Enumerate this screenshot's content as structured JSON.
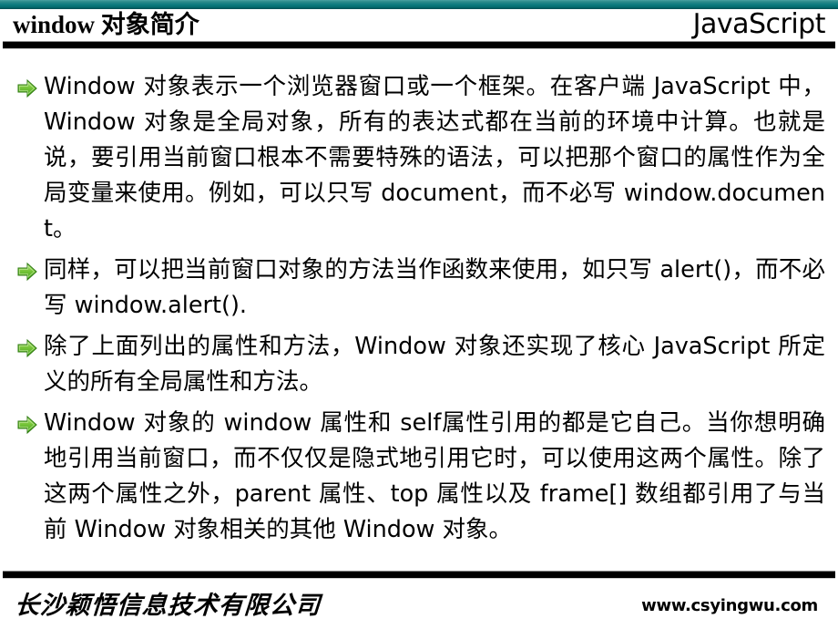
{
  "slide": {
    "header": {
      "title": "window 对象简介",
      "brand": "JavaScript",
      "gradient_from": "#4ba3a3",
      "gradient_to": "#014e52",
      "rule_color": "#000000"
    },
    "bullets": [
      {
        "icon": "green-arrow-bullet-icon",
        "text": "Window 对象表示一个浏览器窗口或一个框架。在客户端 JavaScript 中，Window 对象是全局对象，所有的表达式都在当前的环境中计算。也就是说，要引用当前窗口根本不需要特殊的语法，可以把那个窗口的属性作为全局变量来使用。例如，可以只写 document，而不必写 window.document。"
      },
      {
        "icon": "green-arrow-bullet-icon",
        "text": "同样，可以把当前窗口对象的方法当作函数来使用，如只写 alert()，而不必写 window.alert()."
      },
      {
        "icon": "green-arrow-bullet-icon",
        "text": "除了上面列出的属性和方法，Window 对象还实现了核心 JavaScript 所定义的所有全局属性和方法。"
      },
      {
        "icon": "green-arrow-bullet-icon",
        "text": "Window 对象的 window 属性和 self属性引用的都是它自己。当你想明确地引用当前窗口，而不仅仅是隐式地引用它时，可以使用这两个属性。除了这两个属性之外，parent 属性、top 属性以及 frame[] 数组都引用了与当前 Window 对象相关的其他 Window 对象。"
      }
    ],
    "footer": {
      "company": "长沙颖悟信息技术有限公司",
      "url": "www.csyingwu.com"
    },
    "colors": {
      "bullet_green_light": "#8ed14f",
      "bullet_green_dark": "#3f9e1b",
      "text": "#000000",
      "background": "#ffffff"
    }
  }
}
